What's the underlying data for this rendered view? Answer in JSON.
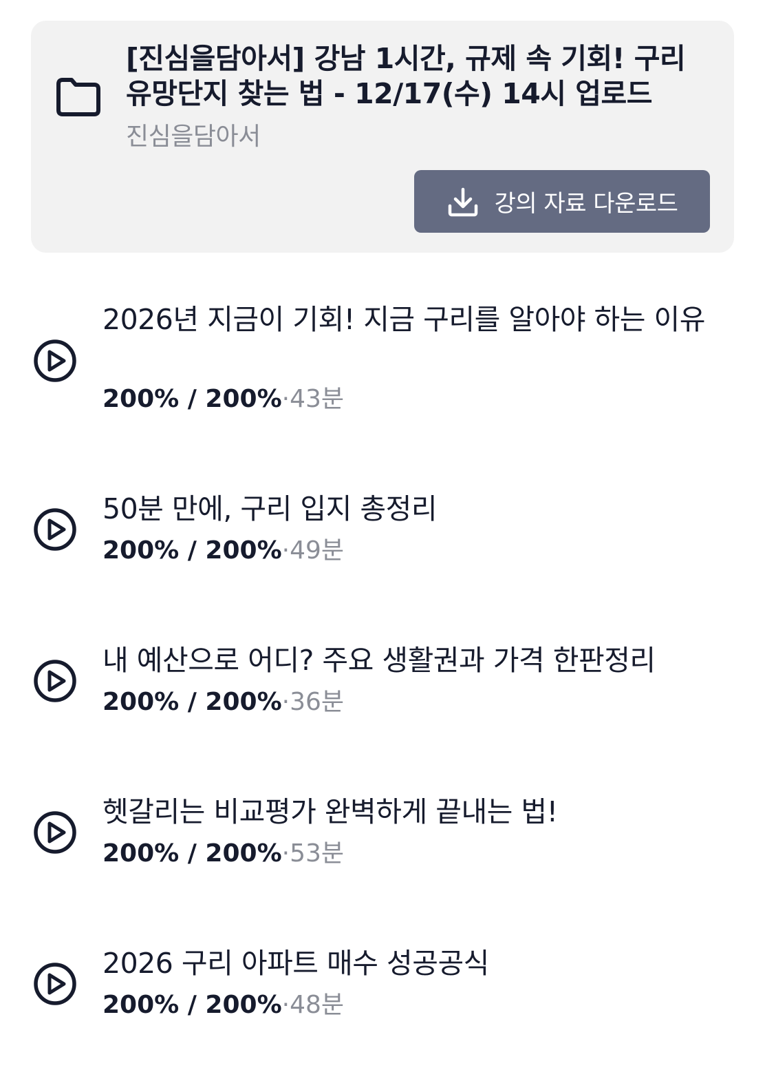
{
  "course": {
    "title": "[진심을담아서] 강남 1시간, 규제 속 기회! 구리 유망단지 찾는 법 - 12/17(수) 14시 업로드",
    "author": "진심을담아서",
    "download_label": "강의 자료 다운로드",
    "folder_icon": "folder-icon",
    "download_icon": "download-icon"
  },
  "lecture_meta_separator": "·",
  "colors": {
    "card_bg": "#f2f2f2",
    "button_bg": "#646b82",
    "text_dark": "#161b2d",
    "text_muted": "#8a8d96"
  },
  "lectures": [
    {
      "title": "2026년 지금이 기회! 지금 구리를 알아야 하는 이유",
      "progress": "200% / 200%",
      "duration": "43분",
      "icon": "play-circle-icon"
    },
    {
      "title": "50분 만에, 구리 입지 총정리",
      "progress": "200% / 200%",
      "duration": "49분",
      "icon": "play-circle-icon"
    },
    {
      "title": "내 예산으로 어디? 주요 생활권과 가격 한판정리",
      "progress": "200% / 200%",
      "duration": "36분",
      "icon": "play-circle-icon"
    },
    {
      "title": "헷갈리는 비교평가 완벽하게 끝내는 법!",
      "progress": "200% / 200%",
      "duration": "53분",
      "icon": "play-circle-icon"
    },
    {
      "title": "2026 구리 아파트 매수 성공공식",
      "progress": "200% / 200%",
      "duration": "48분",
      "icon": "play-circle-icon"
    }
  ]
}
